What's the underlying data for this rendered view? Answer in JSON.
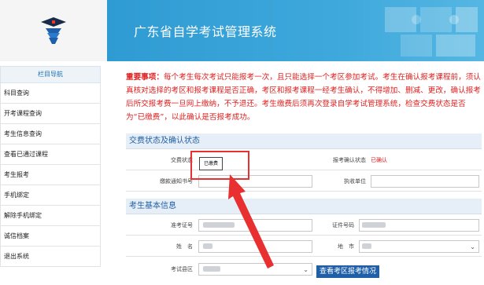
{
  "header": {
    "title": "广东省自学考试管理系统"
  },
  "sidebar": {
    "heading": "栏目导航",
    "items": [
      {
        "label": "科目查询"
      },
      {
        "label": "开考课程查询"
      },
      {
        "label": "考生信息查询"
      },
      {
        "label": "查看已通过课程"
      },
      {
        "label": "考生报考"
      },
      {
        "label": "手机绑定"
      },
      {
        "label": "解除手机绑定"
      },
      {
        "label": "诚信档案"
      },
      {
        "label": "退出系统"
      }
    ]
  },
  "notice": {
    "label": "重要事项：",
    "text": "每个考生每次考试只能报考一次，且只能选择一个考区参加考试。考生在确认报考课程前，须认真核对选择的考区和报考课程是否正确，考区和报考课程一经考生确认，不得增加、删减、更改，确认报考后所交报考费一旦网上缴纳，不予退还。考生缴费后须再次登录自学考试管理系统，检查交费状态是否为“已缴费”，以此确认是否报考成功。"
  },
  "payment_section": {
    "title": "交费状态及确认状态",
    "fee_status_label": "交费状态",
    "fee_status_value": "已缴费",
    "confirm_status_label": "报考确认状态",
    "confirm_status_value": "已确认",
    "notice_no_label": "缴款通知书号",
    "paying_unit_label": "执收单位"
  },
  "basic_section": {
    "title": "考生基本信息",
    "exam_no_label": "准考证号",
    "id_no_label": "证件号码",
    "name_label": "姓　名",
    "city_label": "地　市",
    "exam_area_label": "考试县区",
    "check_button": "查看考区报考情况"
  },
  "colors": {
    "header": "#3ea8dc",
    "notice": "#e02020",
    "highlight": "#e83030",
    "button": "#1e5fa8"
  }
}
